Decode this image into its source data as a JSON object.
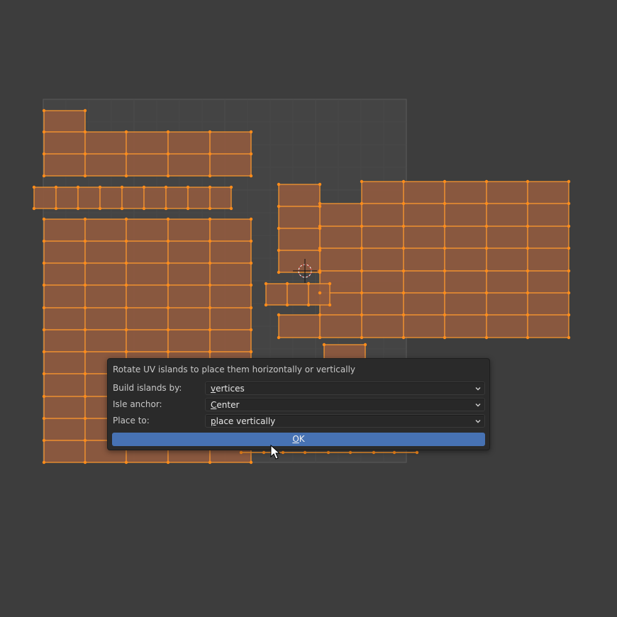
{
  "dialog": {
    "title": "Rotate UV islands to place them horizontally or vertically",
    "fields": [
      {
        "label": "Build islands by:",
        "value_first": "v",
        "value_rest": "ertices",
        "icon": "chevron-down-icon"
      },
      {
        "label": "Isle anchor:",
        "value_first": "C",
        "value_rest": "enter",
        "icon": "chevron-down-icon"
      },
      {
        "label": "Place to:",
        "value_first": "p",
        "value_rest": "lace vertically",
        "icon": "chevron-down-icon"
      }
    ],
    "ok_first": "O",
    "ok_rest": "K"
  },
  "colors": {
    "background": "#3d3d3d",
    "uv_bounds": "#444444",
    "grid": "#4b4b4b",
    "face_fill": "#8f5a3f",
    "edge": "#ff9a2e",
    "vertex": "#ff8c1a",
    "ok_button": "#4772b3"
  },
  "cursor_icon": "mouse-pointer-icon",
  "cursor3d_icon": "2d-cursor-icon"
}
